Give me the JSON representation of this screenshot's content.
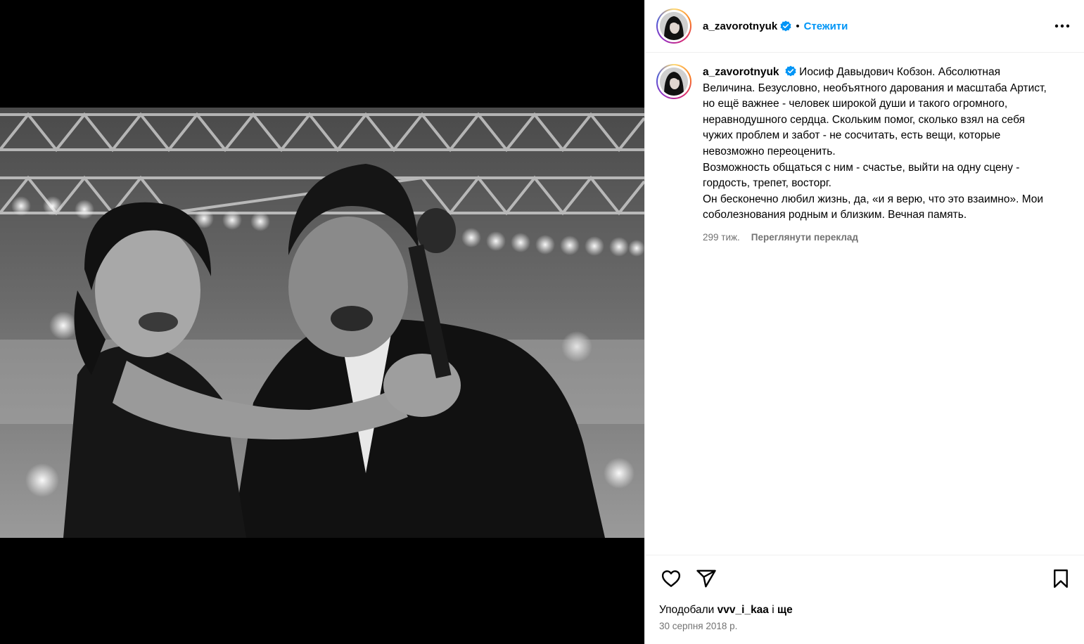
{
  "post": {
    "username": "a_zavorotnyuk",
    "dot": "•",
    "follow_label": "Стежити",
    "more_label": "•••"
  },
  "caption": {
    "username": "a_zavorotnyuk",
    "text": "Иосиф Давыдович Кобзон. Абсолютная Величина. Безусловно, необъятного дарования и масштаба Артист, но ещё важнее - человек широкой души и такого огромного, неравнодушного сердца. Скольким помог, сколько взял на себя чужих проблем и забот - не сосчитать, есть вещи, которые невозможно переоценить.\nВозможность общаться с ним - счастье, выйти на одну сцену - гордость, трепет, восторг.\nОн бесконечно любил жизнь, да, «и я верю, что это взаимно». Мои соболезнования родным и близким. Вечная память.",
    "age": "299 тиж.",
    "translate_label": "Переглянути переклад"
  },
  "footer": {
    "likes_prefix": "Уподобали",
    "likes_user": "vvv_i_kaa",
    "likes_conj": "і",
    "likes_suffix": "ще",
    "date": "30 серпня 2018 р."
  },
  "colors": {
    "accent": "#0095f6",
    "secondary_text": "#737373",
    "media_background": "#000000"
  },
  "icons": [
    "verified-badge-icon",
    "more-options-icon",
    "heart-icon",
    "share-icon",
    "bookmark-icon"
  ]
}
